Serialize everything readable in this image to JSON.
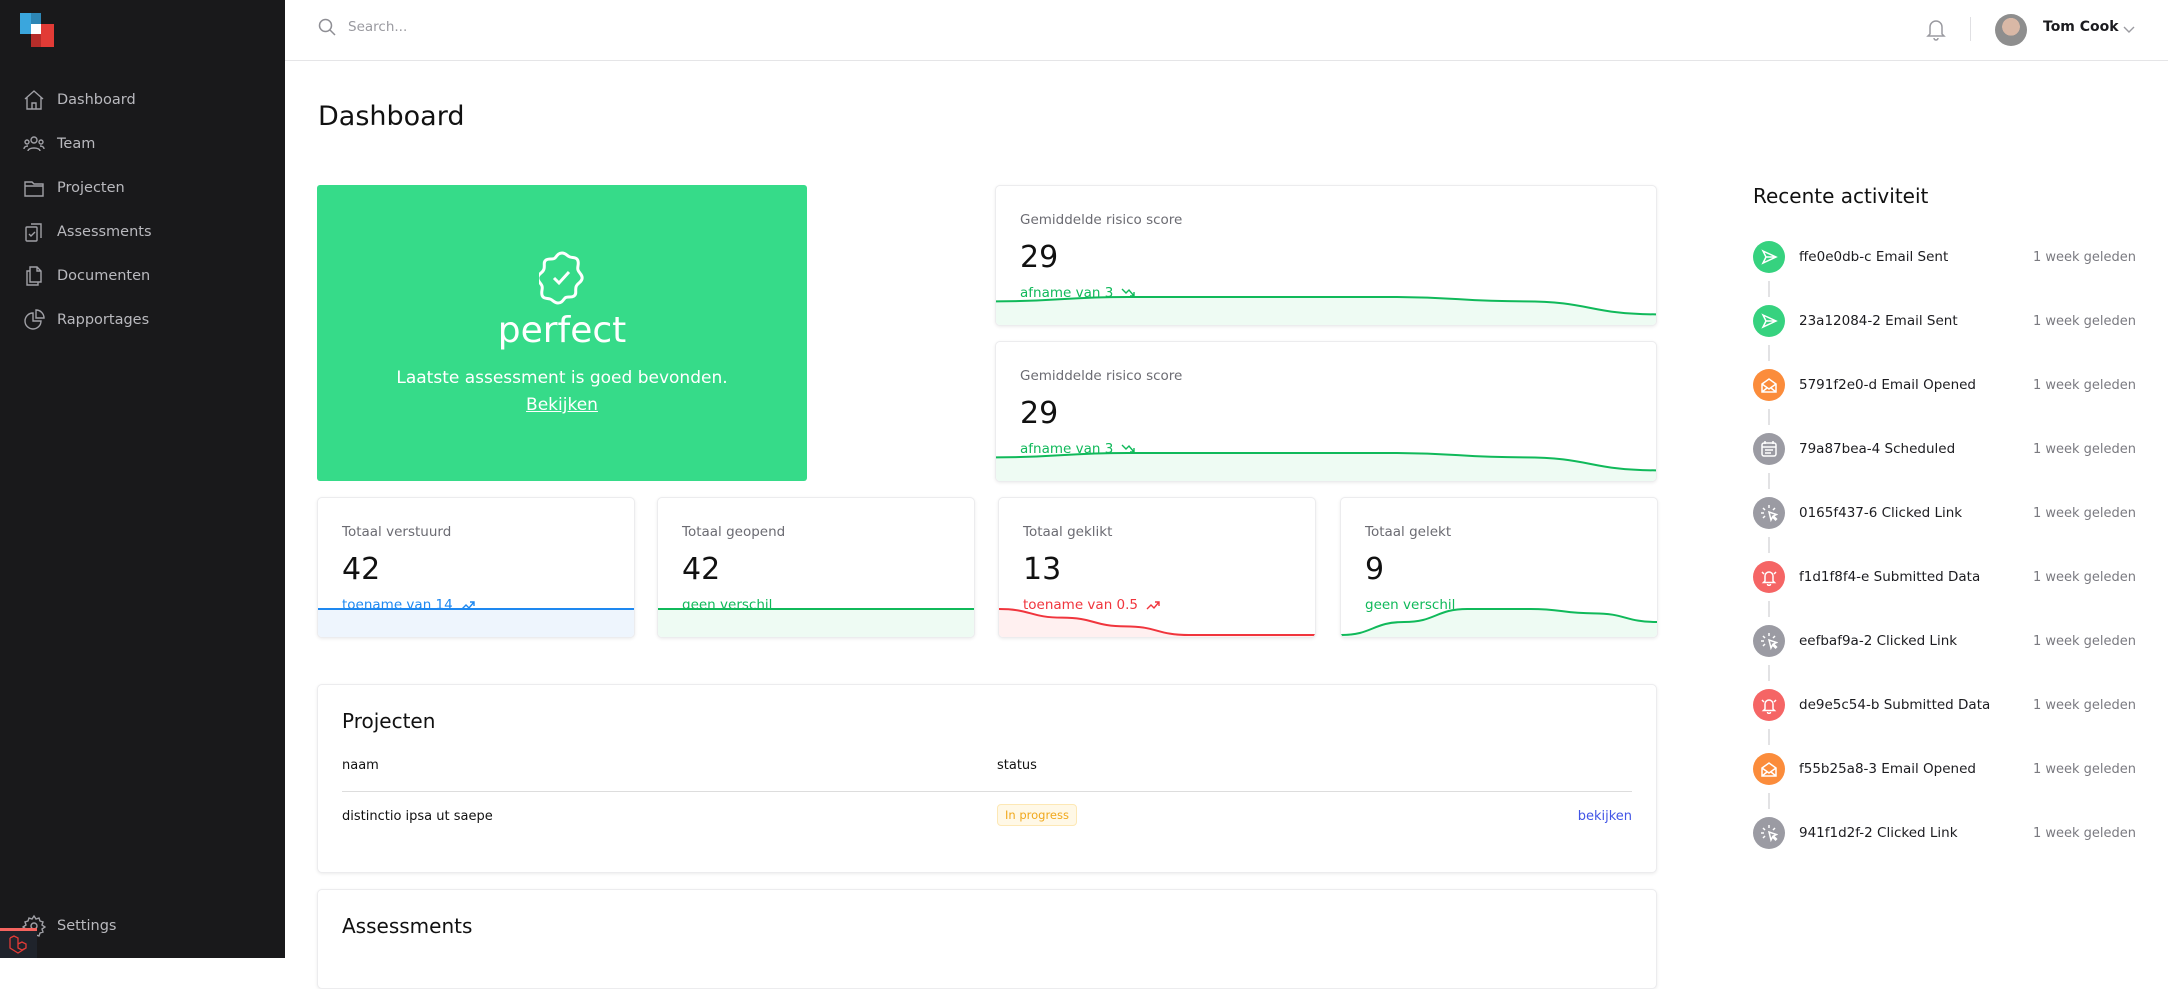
{
  "brand": {
    "colors": {
      "blue": "#3aa6dd",
      "red": "#e23b36"
    }
  },
  "sidebar": {
    "items": [
      {
        "label": "Dashboard",
        "icon": "home-icon"
      },
      {
        "label": "Team",
        "icon": "users-icon"
      },
      {
        "label": "Projecten",
        "icon": "folder-icon"
      },
      {
        "label": "Assessments",
        "icon": "clipboard-check-icon"
      },
      {
        "label": "Documenten",
        "icon": "documents-icon"
      },
      {
        "label": "Rapportages",
        "icon": "pie-chart-icon"
      }
    ],
    "settings": {
      "label": "Settings",
      "icon": "gear-icon"
    }
  },
  "header": {
    "search_placeholder": "Search...",
    "user_name": "Tom Cook"
  },
  "page": {
    "title": "Dashboard"
  },
  "hero": {
    "status": "perfect",
    "message": "Laatste assessment is goed bevonden.",
    "link": "Bekijken",
    "color": "#36db89"
  },
  "risk_cards": [
    {
      "label": "Gemiddelde risico score",
      "value": "29",
      "change": "afname van 3",
      "direction": "down",
      "color": "#10b95a",
      "trend": [
        5,
        6,
        6,
        6,
        5,
        2
      ]
    },
    {
      "label": "Gemiddelde risico score",
      "value": "29",
      "change": "afname van 3",
      "direction": "down",
      "color": "#10b95a",
      "trend": [
        5,
        6,
        6,
        6,
        5,
        2
      ]
    }
  ],
  "stat_cards": [
    {
      "label": "Totaal verstuurd",
      "value": "42",
      "change": "toename van 14",
      "direction": "up",
      "color": "#1e88f0",
      "trend": [
        5,
        5,
        5,
        5,
        5,
        5
      ]
    },
    {
      "label": "Totaal geopend",
      "value": "42",
      "change": "geen verschil",
      "direction": "none",
      "color": "#10b95a",
      "trend": [
        5,
        5,
        5,
        5,
        5,
        5
      ]
    },
    {
      "label": "Totaal geklikt",
      "value": "13",
      "change": "toename van 0.5",
      "direction": "up",
      "color": "#f0353d",
      "trend": [
        6,
        4,
        2,
        0,
        0,
        0
      ]
    },
    {
      "label": "Totaal gelekt",
      "value": "9",
      "change": "geen verschil",
      "direction": "none",
      "color": "#10b95a",
      "trend": [
        0,
        3,
        6,
        6,
        5,
        3
      ]
    }
  ],
  "projects": {
    "title": "Projecten",
    "columns": [
      "naam",
      "status"
    ],
    "rows": [
      {
        "name": "distinctio ipsa ut saepe",
        "status": "In progress",
        "action": "bekijken"
      }
    ]
  },
  "assessments": {
    "title": "Assessments"
  },
  "activity": {
    "title": "Recente activiteit",
    "items": [
      {
        "text": "ffe0e0db-c Email Sent",
        "time": "1 week geleden",
        "type": "sent"
      },
      {
        "text": "23a12084-2 Email Sent",
        "time": "1 week geleden",
        "type": "sent"
      },
      {
        "text": "5791f2e0-d Email Opened",
        "time": "1 week geleden",
        "type": "opened"
      },
      {
        "text": "79a87bea-4 Scheduled",
        "time": "1 week geleden",
        "type": "scheduled"
      },
      {
        "text": "0165f437-6 Clicked Link",
        "time": "1 week geleden",
        "type": "clicked"
      },
      {
        "text": "f1d1f8f4-e Submitted Data",
        "time": "1 week geleden",
        "type": "submitted"
      },
      {
        "text": "eefbaf9a-2 Clicked Link",
        "time": "1 week geleden",
        "type": "clicked"
      },
      {
        "text": "de9e5c54-b Submitted Data",
        "time": "1 week geleden",
        "type": "submitted"
      },
      {
        "text": "f55b25a8-3 Email Opened",
        "time": "1 week geleden",
        "type": "opened"
      },
      {
        "text": "941f1d2f-2 Clicked Link",
        "time": "1 week geleden",
        "type": "clicked"
      }
    ]
  }
}
